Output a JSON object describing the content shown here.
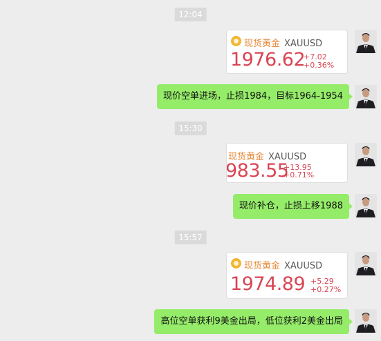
{
  "messages": [
    {
      "type": "time",
      "text": "12:04"
    },
    {
      "type": "card",
      "name": "现货黄金",
      "symbol": "XAUUSD",
      "price": "1976.62",
      "change": "+7.02",
      "change_pct": "+0.36%"
    },
    {
      "type": "text",
      "text": "现价空单进场，止损1984，目标1964-1954"
    },
    {
      "type": "time",
      "text": "15:30"
    },
    {
      "type": "card",
      "name": "现货黄金",
      "symbol": "XAUUSD",
      "price": "983.55",
      "change": "+13.95",
      "change_pct": "+0.71%"
    },
    {
      "type": "text",
      "text": "现价补仓，止损上移1988"
    },
    {
      "type": "time",
      "text": "15:57"
    },
    {
      "type": "card",
      "name": "现货黄金",
      "symbol": "XAUUSD",
      "price": "1974.89",
      "change": "+5.29",
      "change_pct": "+0.27%"
    },
    {
      "type": "text",
      "text": "高位空单获利9美金出局，低位获利2美金出局"
    }
  ],
  "icons": {
    "coin": "gold-coin-icon",
    "avatar": "user-avatar"
  },
  "colors": {
    "bubble": "#95ec69",
    "price": "#d94452",
    "name": "#e58a3a",
    "coin": "#f2b635"
  }
}
